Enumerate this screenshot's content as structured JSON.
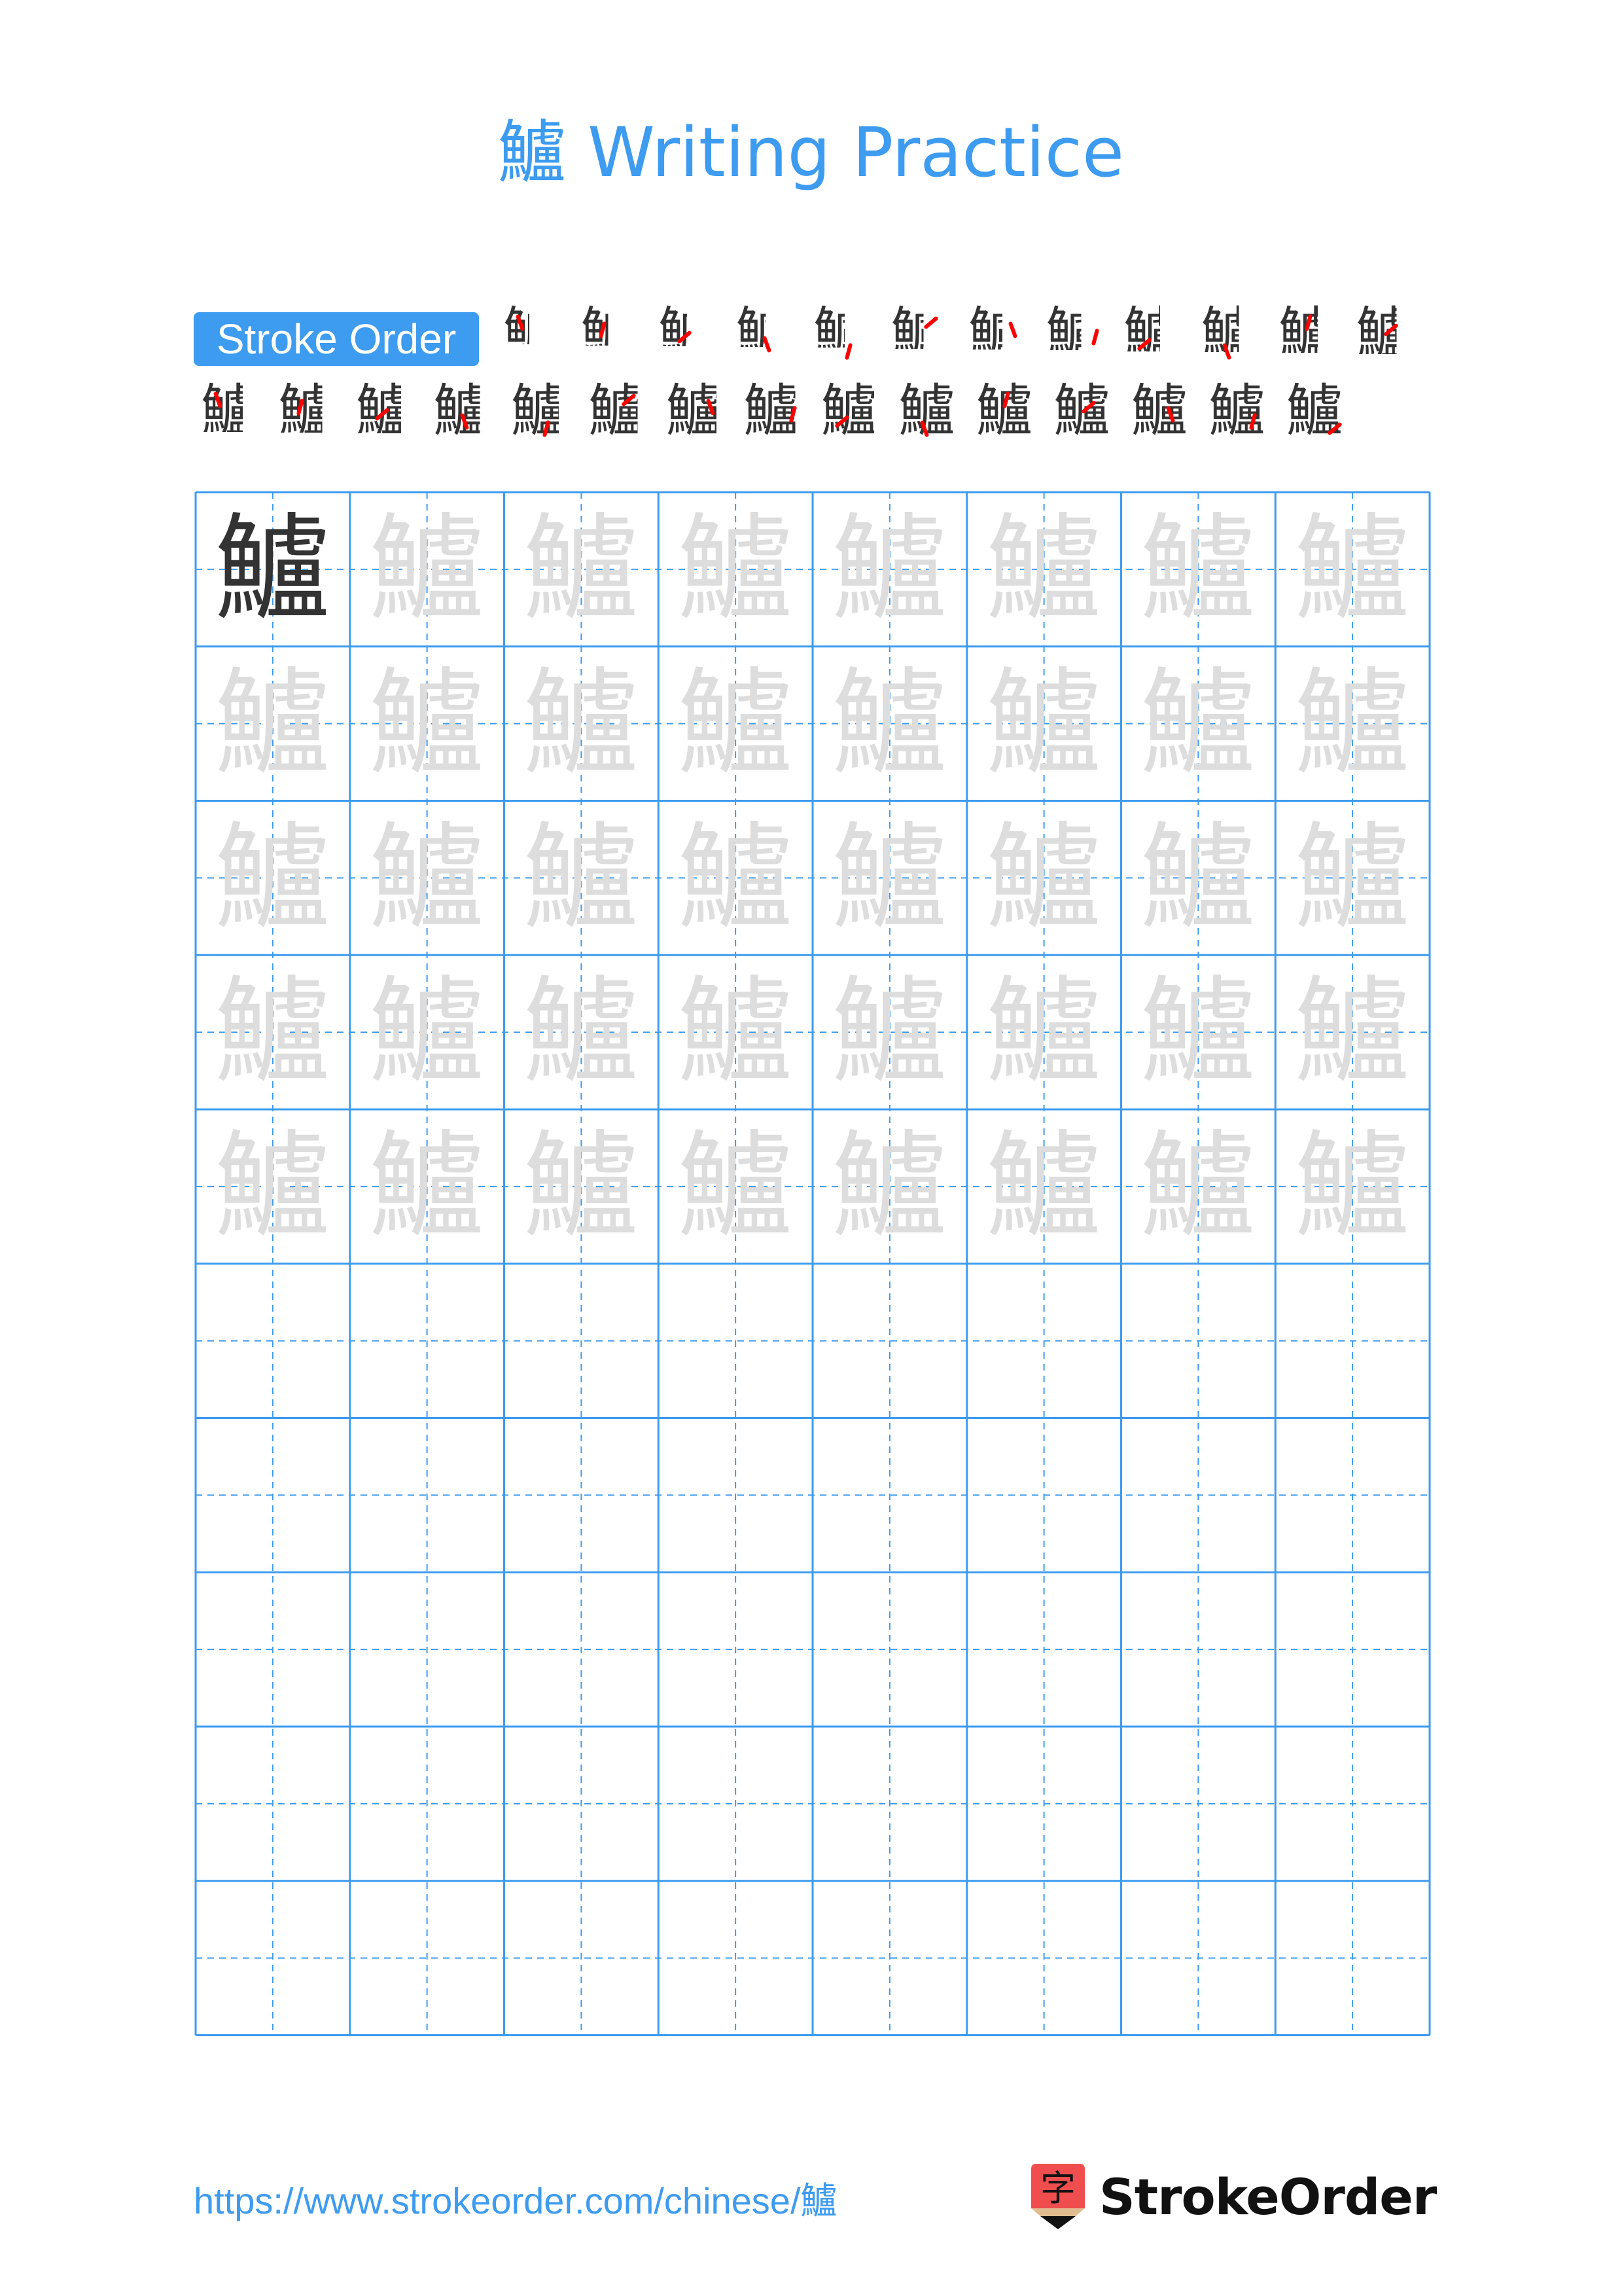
{
  "page": {
    "title": "鱸 Writing Practice",
    "character": "鱸",
    "accent_color": "#3D9BF0",
    "stroke_highlight_color": "#FF0000"
  },
  "stroke_order": {
    "label": "Stroke Order",
    "total_strokes": 27,
    "rows": [
      {
        "steps": [
          1,
          2,
          3,
          4,
          5,
          6,
          7,
          8,
          9,
          10,
          11,
          12
        ]
      },
      {
        "steps": [
          13,
          14,
          15,
          16,
          17,
          18,
          19,
          20,
          21,
          22,
          23,
          24,
          25,
          26,
          27
        ]
      }
    ]
  },
  "practice_grid": {
    "columns": 8,
    "rows": 10,
    "filled_rows": 5,
    "model_cell_color": "#333333",
    "trace_cell_color": "#DDDDDD",
    "line_color": "#3D9BF0"
  },
  "footer": {
    "url": "https://www.strokeorder.com/chinese/鱸",
    "logo_icon_char": "字",
    "logo_text": "StrokeOrder"
  }
}
